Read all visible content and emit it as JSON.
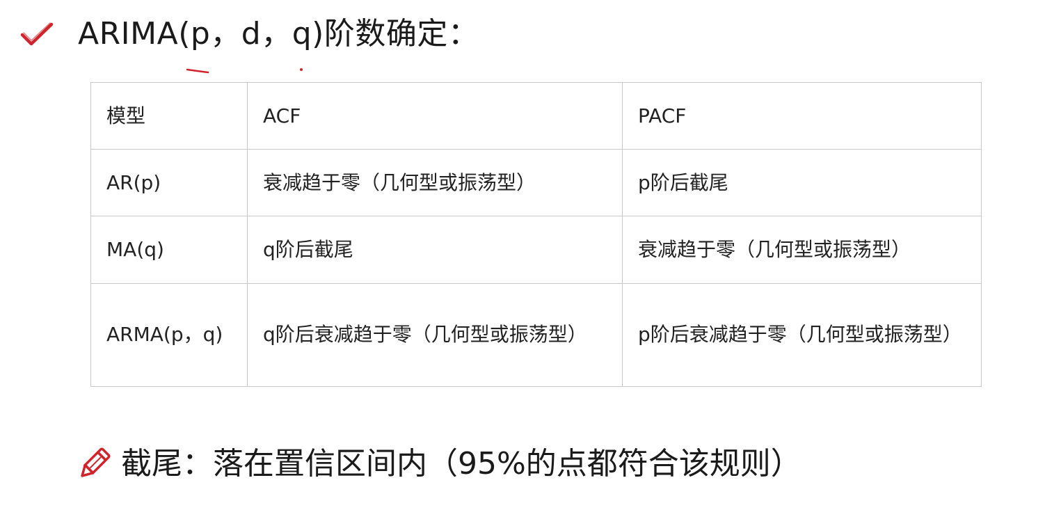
{
  "title": {
    "text": "ARIMA(p，d，q)阶数确定：",
    "icon": "check-icon"
  },
  "table": {
    "headers": [
      "模型",
      "ACF",
      "PACF"
    ],
    "rows": [
      {
        "model": "AR(p)",
        "acf": "衰减趋于零（几何型或振荡型）",
        "pacf": "p阶后截尾"
      },
      {
        "model": "MA(q)",
        "acf": "q阶后截尾",
        "pacf": "衰减趋于零（几何型或振荡型）"
      },
      {
        "model": "ARMA(p，q)",
        "acf": "q阶后衰减趋于零（几何型或振荡型）",
        "pacf": "p阶后衰减趋于零（几何型或振荡型）"
      }
    ]
  },
  "note": {
    "text": "截尾：落在置信区间内（95%的点都符合该规则）",
    "icon": "pencil-icon"
  },
  "colors": {
    "accent": "#d0242c",
    "border": "#c8c8c8",
    "text": "#222222"
  }
}
